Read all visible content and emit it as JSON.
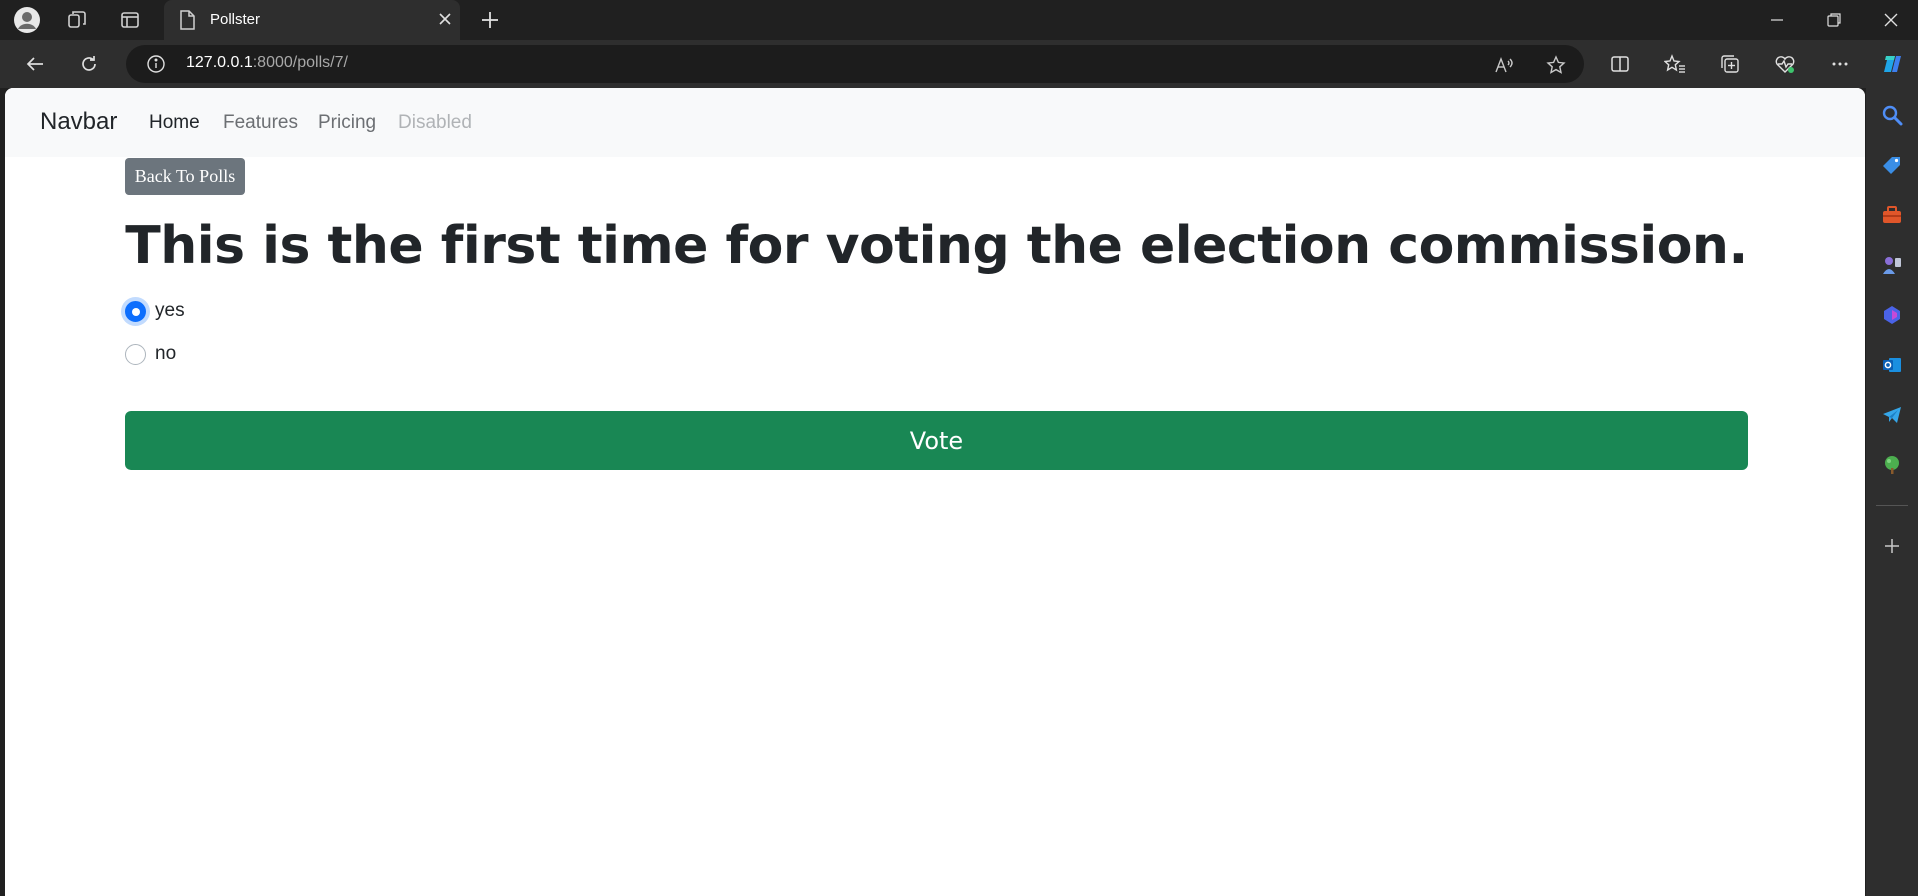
{
  "browser": {
    "tab_title": "Pollster",
    "url_host": "127.0.0.1",
    "url_rest": ":8000/polls/7/"
  },
  "navbar": {
    "brand": "Navbar",
    "links": [
      {
        "label": "Home",
        "state": "active"
      },
      {
        "label": "Features",
        "state": "normal"
      },
      {
        "label": "Pricing",
        "state": "normal"
      },
      {
        "label": "Disabled",
        "state": "disabled"
      }
    ]
  },
  "page": {
    "back_button": "Back To Polls",
    "question": "This is the first time for voting the election commission.",
    "choices": [
      {
        "label": "yes",
        "checked": true
      },
      {
        "label": "no",
        "checked": false
      }
    ],
    "vote_button": "Vote"
  },
  "colors": {
    "vote_green": "#198754",
    "back_gray": "#6c757d",
    "radio_blue": "#0d6efd",
    "navbar_bg": "#f8f9fa"
  },
  "icons": {
    "titlebar": [
      "profile-icon",
      "workspaces-icon",
      "tab-actions-icon",
      "page-icon",
      "close-icon",
      "plus-icon",
      "minimize-icon",
      "restore-icon",
      "window-close-icon"
    ],
    "toolbar": [
      "back-arrow-icon",
      "refresh-icon",
      "info-icon",
      "read-aloud-icon",
      "favorite-star-icon",
      "split-screen-icon",
      "favorites-icon",
      "collections-icon",
      "browser-essentials-icon",
      "more-icon",
      "copilot-icon"
    ],
    "sidebar": [
      "search-icon",
      "shopping-tag-icon",
      "tools-icon",
      "games-icon",
      "microsoft-365-icon",
      "outlook-icon",
      "telegram-icon",
      "tree-icon",
      "add-icon"
    ]
  }
}
